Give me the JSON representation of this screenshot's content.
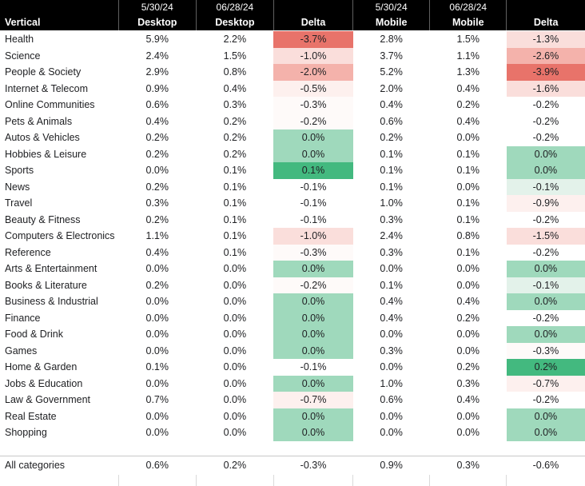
{
  "header": {
    "date_row": [
      "",
      "5/30/24",
      "06/28/24",
      "",
      "5/30/24",
      "06/28/24",
      ""
    ],
    "label_row": [
      "Vertical",
      "Desktop",
      "Desktop",
      "Delta",
      "Mobile",
      "Mobile",
      "Delta"
    ]
  },
  "colors": {
    "header_bg": "#000000",
    "header_text": "#ffffff",
    "text": "#202124",
    "red_strong": "#e8736a",
    "red_mid": "#f4b2ab",
    "red_light": "#fadedb",
    "red_faint": "#fdf0ee",
    "red_trace": "#fefaf9",
    "green_strong": "#43b97f",
    "green_mid": "#9fd9bc",
    "green_light": "#c9e8d8",
    "green_faint": "#e3f2ea",
    "none": "transparent"
  },
  "rows": [
    {
      "vertical": "Health",
      "desktop_a": "5.9%",
      "desktop_b": "2.2%",
      "desktop_delta": "-3.7%",
      "desktop_delta_bg": "#e8736a",
      "mobile_a": "2.8%",
      "mobile_b": "1.5%",
      "mobile_delta": "-1.3%",
      "mobile_delta_bg": "#fadedb"
    },
    {
      "vertical": "Science",
      "desktop_a": "2.4%",
      "desktop_b": "1.5%",
      "desktop_delta": "-1.0%",
      "desktop_delta_bg": "#fadedb",
      "mobile_a": "3.7%",
      "mobile_b": "1.1%",
      "mobile_delta": "-2.6%",
      "mobile_delta_bg": "#f4b2ab"
    },
    {
      "vertical": "People & Society",
      "desktop_a": "2.9%",
      "desktop_b": "0.8%",
      "desktop_delta": "-2.0%",
      "desktop_delta_bg": "#f4b2ab",
      "mobile_a": "5.2%",
      "mobile_b": "1.3%",
      "mobile_delta": "-3.9%",
      "mobile_delta_bg": "#e8736a"
    },
    {
      "vertical": "Internet & Telecom",
      "desktop_a": "0.9%",
      "desktop_b": "0.4%",
      "desktop_delta": "-0.5%",
      "desktop_delta_bg": "#fdf0ee",
      "mobile_a": "2.0%",
      "mobile_b": "0.4%",
      "mobile_delta": "-1.6%",
      "mobile_delta_bg": "#fadedb"
    },
    {
      "vertical": "Online Communities",
      "desktop_a": "0.6%",
      "desktop_b": "0.3%",
      "desktop_delta": "-0.3%",
      "desktop_delta_bg": "#fefaf9",
      "mobile_a": "0.4%",
      "mobile_b": "0.2%",
      "mobile_delta": "-0.2%",
      "mobile_delta_bg": "transparent"
    },
    {
      "vertical": "Pets & Animals",
      "desktop_a": "0.4%",
      "desktop_b": "0.2%",
      "desktop_delta": "-0.2%",
      "desktop_delta_bg": "#fefaf9",
      "mobile_a": "0.6%",
      "mobile_b": "0.4%",
      "mobile_delta": "-0.2%",
      "mobile_delta_bg": "transparent"
    },
    {
      "vertical": "Autos & Vehicles",
      "desktop_a": "0.2%",
      "desktop_b": "0.2%",
      "desktop_delta": "0.0%",
      "desktop_delta_bg": "#9fd9bc",
      "mobile_a": "0.2%",
      "mobile_b": "0.0%",
      "mobile_delta": "-0.2%",
      "mobile_delta_bg": "transparent"
    },
    {
      "vertical": "Hobbies & Leisure",
      "desktop_a": "0.2%",
      "desktop_b": "0.2%",
      "desktop_delta": "0.0%",
      "desktop_delta_bg": "#9fd9bc",
      "mobile_a": "0.1%",
      "mobile_b": "0.1%",
      "mobile_delta": "0.0%",
      "mobile_delta_bg": "#9fd9bc"
    },
    {
      "vertical": "Sports",
      "desktop_a": "0.0%",
      "desktop_b": "0.1%",
      "desktop_delta": "0.1%",
      "desktop_delta_bg": "#43b97f",
      "mobile_a": "0.1%",
      "mobile_b": "0.1%",
      "mobile_delta": "0.0%",
      "mobile_delta_bg": "#9fd9bc"
    },
    {
      "vertical": "News",
      "desktop_a": "0.2%",
      "desktop_b": "0.1%",
      "desktop_delta": "-0.1%",
      "desktop_delta_bg": "transparent",
      "mobile_a": "0.1%",
      "mobile_b": "0.0%",
      "mobile_delta": "-0.1%",
      "mobile_delta_bg": "#e3f2ea"
    },
    {
      "vertical": "Travel",
      "desktop_a": "0.3%",
      "desktop_b": "0.1%",
      "desktop_delta": "-0.1%",
      "desktop_delta_bg": "transparent",
      "mobile_a": "1.0%",
      "mobile_b": "0.1%",
      "mobile_delta": "-0.9%",
      "mobile_delta_bg": "#fdf0ee"
    },
    {
      "vertical": "Beauty & Fitness",
      "desktop_a": "0.2%",
      "desktop_b": "0.1%",
      "desktop_delta": "-0.1%",
      "desktop_delta_bg": "transparent",
      "mobile_a": "0.3%",
      "mobile_b": "0.1%",
      "mobile_delta": "-0.2%",
      "mobile_delta_bg": "transparent"
    },
    {
      "vertical": "Computers & Electronics",
      "desktop_a": "1.1%",
      "desktop_b": "0.1%",
      "desktop_delta": "-1.0%",
      "desktop_delta_bg": "#fadedb",
      "mobile_a": "2.4%",
      "mobile_b": "0.8%",
      "mobile_delta": "-1.5%",
      "mobile_delta_bg": "#fadedb"
    },
    {
      "vertical": "Reference",
      "desktop_a": "0.4%",
      "desktop_b": "0.1%",
      "desktop_delta": "-0.3%",
      "desktop_delta_bg": "#fefaf9",
      "mobile_a": "0.3%",
      "mobile_b": "0.1%",
      "mobile_delta": "-0.2%",
      "mobile_delta_bg": "transparent"
    },
    {
      "vertical": "Arts & Entertainment",
      "desktop_a": "0.0%",
      "desktop_b": "0.0%",
      "desktop_delta": "0.0%",
      "desktop_delta_bg": "#9fd9bc",
      "mobile_a": "0.0%",
      "mobile_b": "0.0%",
      "mobile_delta": "0.0%",
      "mobile_delta_bg": "#9fd9bc"
    },
    {
      "vertical": "Books & Literature",
      "desktop_a": "0.2%",
      "desktop_b": "0.0%",
      "desktop_delta": "-0.2%",
      "desktop_delta_bg": "#fefaf9",
      "mobile_a": "0.1%",
      "mobile_b": "0.0%",
      "mobile_delta": "-0.1%",
      "mobile_delta_bg": "#e3f2ea"
    },
    {
      "vertical": "Business & Industrial",
      "desktop_a": "0.0%",
      "desktop_b": "0.0%",
      "desktop_delta": "0.0%",
      "desktop_delta_bg": "#9fd9bc",
      "mobile_a": "0.4%",
      "mobile_b": "0.4%",
      "mobile_delta": "0.0%",
      "mobile_delta_bg": "#9fd9bc"
    },
    {
      "vertical": "Finance",
      "desktop_a": "0.0%",
      "desktop_b": "0.0%",
      "desktop_delta": "0.0%",
      "desktop_delta_bg": "#9fd9bc",
      "mobile_a": "0.4%",
      "mobile_b": "0.2%",
      "mobile_delta": "-0.2%",
      "mobile_delta_bg": "transparent"
    },
    {
      "vertical": "Food & Drink",
      "desktop_a": "0.0%",
      "desktop_b": "0.0%",
      "desktop_delta": "0.0%",
      "desktop_delta_bg": "#9fd9bc",
      "mobile_a": "0.0%",
      "mobile_b": "0.0%",
      "mobile_delta": "0.0%",
      "mobile_delta_bg": "#9fd9bc"
    },
    {
      "vertical": "Games",
      "desktop_a": "0.0%",
      "desktop_b": "0.0%",
      "desktop_delta": "0.0%",
      "desktop_delta_bg": "#9fd9bc",
      "mobile_a": "0.3%",
      "mobile_b": "0.0%",
      "mobile_delta": "-0.3%",
      "mobile_delta_bg": "#fefaf9"
    },
    {
      "vertical": "Home & Garden",
      "desktop_a": "0.1%",
      "desktop_b": "0.0%",
      "desktop_delta": "-0.1%",
      "desktop_delta_bg": "transparent",
      "mobile_a": "0.0%",
      "mobile_b": "0.2%",
      "mobile_delta": "0.2%",
      "mobile_delta_bg": "#43b97f"
    },
    {
      "vertical": "Jobs & Education",
      "desktop_a": "0.0%",
      "desktop_b": "0.0%",
      "desktop_delta": "0.0%",
      "desktop_delta_bg": "#9fd9bc",
      "mobile_a": "1.0%",
      "mobile_b": "0.3%",
      "mobile_delta": "-0.7%",
      "mobile_delta_bg": "#fdf0ee"
    },
    {
      "vertical": "Law & Government",
      "desktop_a": "0.7%",
      "desktop_b": "0.0%",
      "desktop_delta": "-0.7%",
      "desktop_delta_bg": "#fdf0ee",
      "mobile_a": "0.6%",
      "mobile_b": "0.4%",
      "mobile_delta": "-0.2%",
      "mobile_delta_bg": "transparent"
    },
    {
      "vertical": "Real Estate",
      "desktop_a": "0.0%",
      "desktop_b": "0.0%",
      "desktop_delta": "0.0%",
      "desktop_delta_bg": "#9fd9bc",
      "mobile_a": "0.0%",
      "mobile_b": "0.0%",
      "mobile_delta": "0.0%",
      "mobile_delta_bg": "#9fd9bc"
    },
    {
      "vertical": "Shopping",
      "desktop_a": "0.0%",
      "desktop_b": "0.0%",
      "desktop_delta": "0.0%",
      "desktop_delta_bg": "#9fd9bc",
      "mobile_a": "0.0%",
      "mobile_b": "0.0%",
      "mobile_delta": "0.0%",
      "mobile_delta_bg": "#9fd9bc"
    }
  ],
  "total": {
    "vertical": "All categories",
    "desktop_a": "0.6%",
    "desktop_b": "0.2%",
    "desktop_delta": "-0.3%",
    "mobile_a": "0.9%",
    "mobile_b": "0.3%",
    "mobile_delta": "-0.6%"
  }
}
